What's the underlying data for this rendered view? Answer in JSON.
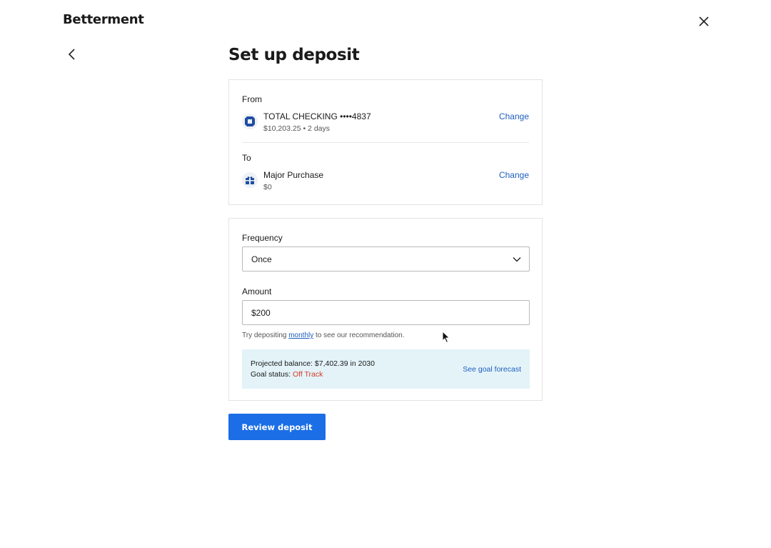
{
  "brand": {
    "name": "Betterment"
  },
  "page": {
    "title": "Set up deposit"
  },
  "accounts": {
    "from": {
      "label": "From",
      "name": "TOTAL CHECKING ••••4837",
      "sub": "$10,203.25 • 2 days",
      "change_label": "Change",
      "icon": "bank-logo-icon"
    },
    "to": {
      "label": "To",
      "name": "Major Purchase",
      "sub": "$0",
      "change_label": "Change",
      "icon": "goal-gift-icon"
    }
  },
  "form": {
    "frequency": {
      "label": "Frequency",
      "value": "Once"
    },
    "amount": {
      "label": "Amount",
      "value": "$200"
    },
    "hint": {
      "prefix": "Try depositing ",
      "link": "monthly",
      "suffix": " to see our recommendation."
    }
  },
  "projection": {
    "balance_text": "Projected balance: $7,402.39 in 2030",
    "status_label": "Goal status: ",
    "status_value": "Off Track",
    "forecast_link": "See goal forecast"
  },
  "actions": {
    "review_label": "Review deposit"
  },
  "colors": {
    "accent": "#1b6ee6",
    "link": "#1f5fbf",
    "warning": "#d63a2a",
    "info_bg": "#e3f3f8"
  }
}
